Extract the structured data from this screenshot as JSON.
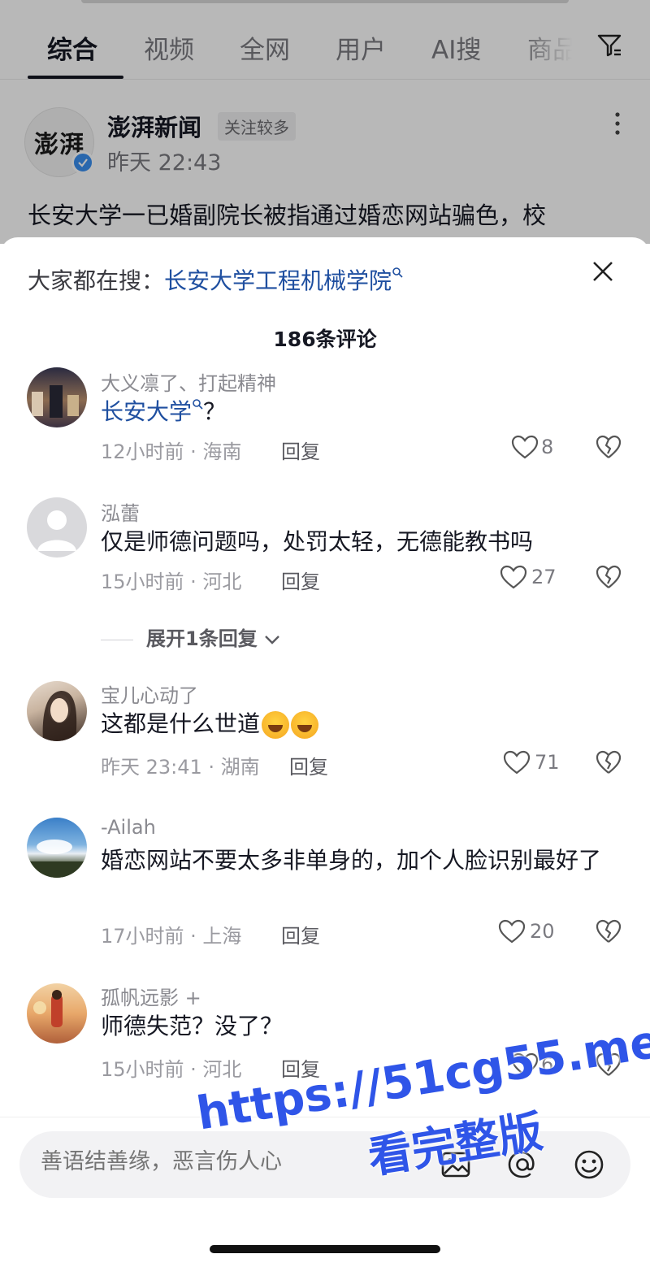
{
  "tabs": [
    "综合",
    "视频",
    "全网",
    "用户",
    "AI搜",
    "商品"
  ],
  "post": {
    "author": "澎湃新闻",
    "tag": "关注较多",
    "time": "昨天 22:43",
    "text": "长安大学一已婚副院长被指通过婚恋网站骗色，校",
    "avatar_text": "澎湃"
  },
  "sheet": {
    "trending_prefix": "大家都在搜：",
    "trending_link": "长安大学工程机械学院",
    "comment_count": "186条评论"
  },
  "comments": [
    {
      "name": "大义凛了、打起精神",
      "text_link": "长安大学",
      "text": "？",
      "meta": "12小时前 · 海南",
      "reply": "回复",
      "likes": "8"
    },
    {
      "name": "泓蕾",
      "text": "仅是师德问题吗，处罚太轻，无德能教书吗",
      "meta": "15小时前 · 河北",
      "reply": "回复",
      "likes": "27",
      "expand": "展开1条回复"
    },
    {
      "name": "宝儿心动了",
      "text": "这都是什么世道",
      "meta": "昨天 23:41 · 湖南",
      "reply": "回复",
      "likes": "71"
    },
    {
      "name": "-Ailah",
      "text": "婚恋网站不要太多非单身的，加个人脸识别最好了",
      "meta": "17小时前 · 上海",
      "reply": "回复",
      "likes": "20"
    },
    {
      "name": "孤帆远影 +",
      "text": "师德失范？没了？",
      "meta": "15小时前 · 河北",
      "reply": "回复",
      "likes": "6"
    }
  ],
  "input": {
    "placeholder": "善语结善缘，恶言伤人心"
  },
  "watermark": {
    "line1": "https://51cg55.me",
    "line2": "看完整版"
  },
  "colors": {
    "link": "#1f4fa0",
    "watermark": "#2f55e8"
  }
}
